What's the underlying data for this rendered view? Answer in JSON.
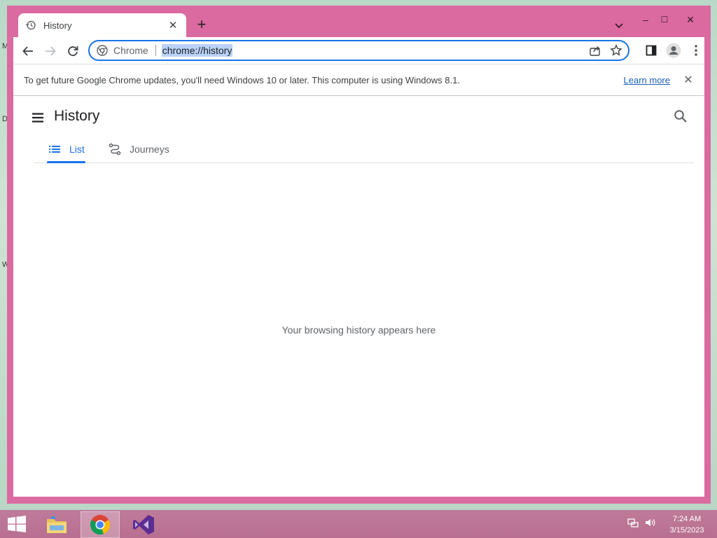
{
  "desktop": {
    "glyphs": [
      "M",
      "D",
      "W"
    ]
  },
  "window": {
    "controls": {
      "minimize": "–",
      "maximize": "☐",
      "close": "✕"
    },
    "tab": {
      "title": "History",
      "icon": "history-clock-icon"
    },
    "new_tab_label": "+"
  },
  "toolbar": {
    "omnibox": {
      "chip": "Chrome",
      "url": "chrome://history"
    }
  },
  "infobar": {
    "message": "To get future Google Chrome updates, you'll need Windows 10 or later. This computer is using Windows 8.1.",
    "link": "Learn more",
    "close": "✕"
  },
  "page": {
    "title": "History",
    "tabs": [
      {
        "label": "List",
        "icon": "list-icon",
        "active": true
      },
      {
        "label": "Journeys",
        "icon": "journeys-icon",
        "active": false
      }
    ],
    "empty_message": "Your browsing history appears here"
  },
  "taskbar": {
    "apps": [
      "file-explorer-icon",
      "chrome-icon",
      "visual-studio-icon"
    ],
    "clock": {
      "time": "7:24 AM",
      "date": "3/15/2023"
    }
  },
  "colors": {
    "accent": "#1a73e8",
    "window_frame": "#db6aa0",
    "taskbar": "#bf7b9a"
  }
}
